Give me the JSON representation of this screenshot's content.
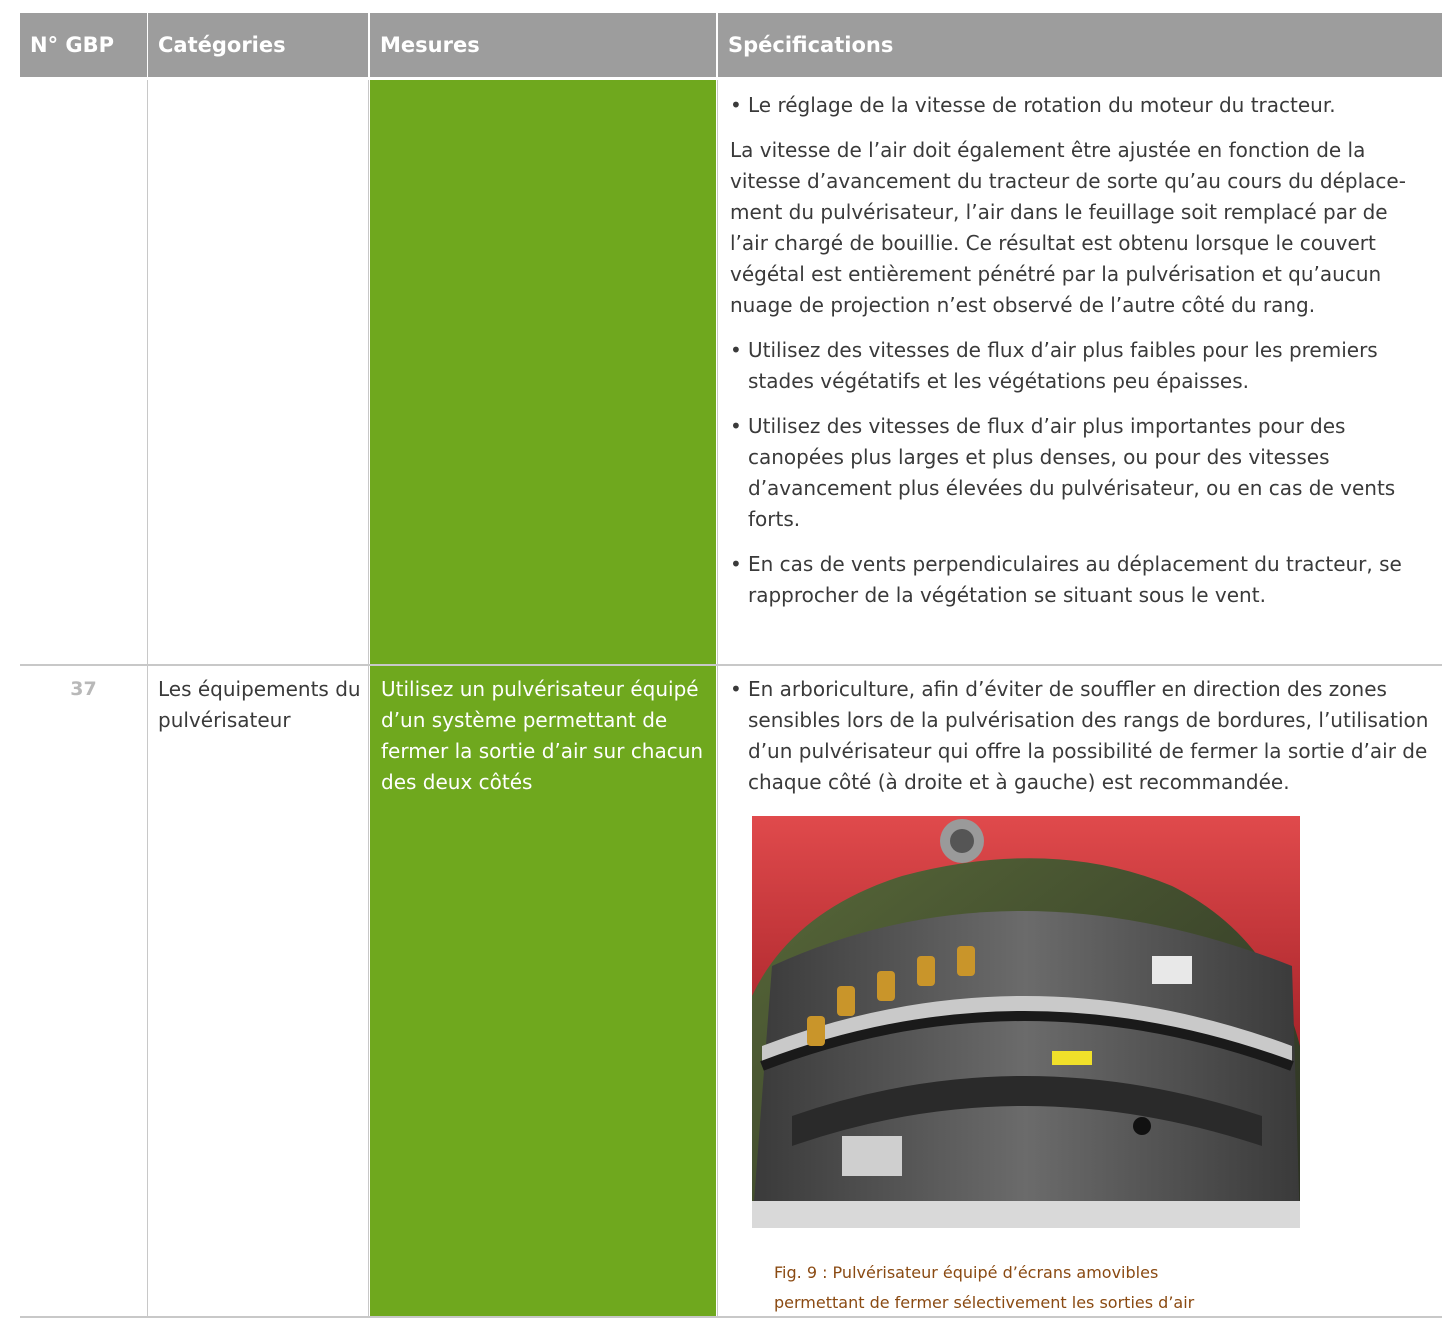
{
  "header": {
    "col_num": "N° GBP",
    "col_categories": "Catégories",
    "col_mesures": "Mesures",
    "col_specifications": "Spécifications"
  },
  "row_continued": {
    "spec_1": "Le réglage de la vitesse de rotation du moteur du tracteur.",
    "spec_2": "La vitesse de l’air doit également être ajustée en fonction de la vitesse d’avancement du tracteur de sorte qu’au cours du déplace-ment du pulvérisateur, l’air dans le feuillage soit remplacé par de l’air chargé de bouillie. Ce résultat est obtenu lorsque le couvert végétal est entièrement pénétré par la pulvérisation et qu’aucun nuage de projection n’est observé de l’autre côté du rang.",
    "spec_3": "Utilisez des vitesses de flux d’air plus faibles pour les premiers stades végétatifs et les végétations peu épaisses.",
    "spec_4": "Utilisez des vitesses de flux d’air plus importantes pour des canopées plus larges et plus denses, ou pour des vitesses d’avancement plus élevées du pulvérisateur, ou en cas de vents forts.",
    "spec_5": "En cas de vents perpendiculaires au déplacement du tracteur, se rapprocher de la végétation se situant sous le vent."
  },
  "row_37": {
    "num": "37",
    "category": "Les équipements du pulvérisateur",
    "mesure": "Utilisez un pulvérisateur équipé d’un système permettant de fermer la sortie d’air sur chacun des deux côtés",
    "spec_1": "En arboriculture, afin d’éviter de souffler en direction des zones sensibles lors de la pulvérisation des rangs de bordures, l’utilisation d’un pulvérisateur qui offre la possibilité de fermer la sortie d’air de chaque côté (à droite et à gauche) est recommandée.",
    "caption_line1": "Fig. 9 : Pulvérisateur équipé d’écrans amovibles",
    "caption_line2": "permettant de fermer sélectivement les sorties d’air"
  },
  "colors": {
    "header_bg": "#9d9d9d",
    "mesures_green": "#6fa81e",
    "caption_brown": "#8a4a12",
    "number_grey": "#b8b8b8"
  }
}
